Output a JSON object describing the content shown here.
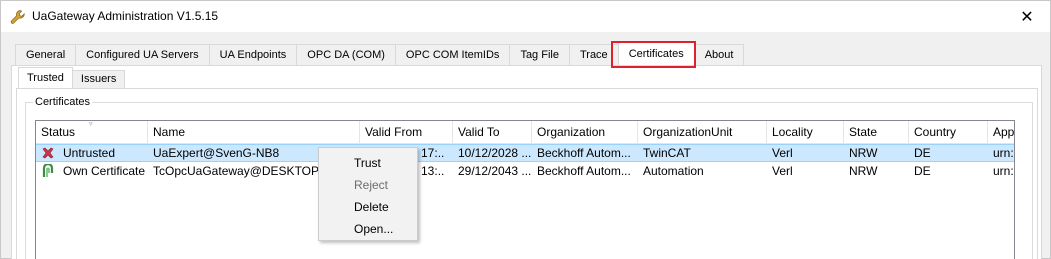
{
  "window": {
    "title": "UaGateway Administration V1.5.15",
    "icon": "wrench-icon",
    "close_glyph": "✕"
  },
  "tabs": [
    {
      "label": "General",
      "active": false
    },
    {
      "label": "Configured UA Servers",
      "active": false
    },
    {
      "label": "UA Endpoints",
      "active": false
    },
    {
      "label": "OPC DA (COM)",
      "active": false
    },
    {
      "label": "OPC COM ItemIDs",
      "active": false
    },
    {
      "label": "Tag File",
      "active": false
    },
    {
      "label": "Trace",
      "active": false
    },
    {
      "label": "Certificates",
      "active": true
    },
    {
      "label": "About",
      "active": false
    }
  ],
  "subtabs": [
    {
      "label": "Trusted",
      "active": true
    },
    {
      "label": "Issuers",
      "active": false
    }
  ],
  "group": {
    "label": "Certificates"
  },
  "columns": [
    "Status",
    "Name",
    "Valid From",
    "Valid To",
    "Organization",
    "OrganizationUnit",
    "Locality",
    "State",
    "Country",
    "App"
  ],
  "rows": [
    {
      "icon": "red-x-icon",
      "selected": true,
      "cells": [
        "Untrusted",
        "UaExpert@SvenG-NB8",
        "3 17:..",
        "10/12/2028 ...",
        "Beckhoff Autom...",
        "TwinCAT",
        "Verl",
        "NRW",
        "DE",
        "urn:"
      ]
    },
    {
      "icon": "green-certificate-icon",
      "selected": false,
      "cells": [
        "Own Certificate",
        "TcOpcUaGateway@DESKTOP-28",
        "4 13:..",
        "29/12/2043 ...",
        "Beckhoff Autom...",
        "Automation",
        "Verl",
        "NRW",
        "DE",
        "urn:"
      ]
    }
  ],
  "context_menu": [
    {
      "label": "Trust",
      "enabled": true
    },
    {
      "label": "Reject",
      "enabled": false
    },
    {
      "label": "Delete",
      "enabled": true
    },
    {
      "label": "Open...",
      "enabled": true
    }
  ],
  "colors": {
    "highlight": "#e0202f",
    "selection": "#cce8ff"
  }
}
